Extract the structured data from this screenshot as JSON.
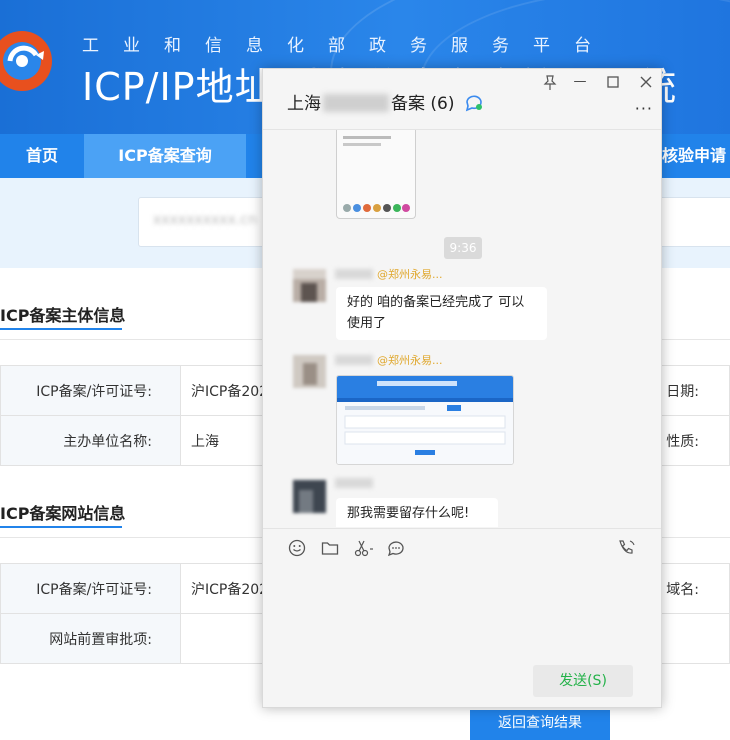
{
  "banner": {
    "slogan": "工业和信息化部政务服务平台",
    "title": "ICP/IP地址/域名信息备案管理系统"
  },
  "nav": {
    "items": [
      "首页",
      "ICP备案查询",
      "核验申请"
    ]
  },
  "search": {
    "value": ""
  },
  "subject_section": {
    "title": "ICP备案主体信息",
    "rows": [
      {
        "label": "ICP备案/许可证号:",
        "value": "沪ICP备202",
        "right_label": "日期:"
      },
      {
        "label": "主办单位名称:",
        "value": "上海",
        "right_label": "性质:"
      }
    ]
  },
  "website_section": {
    "title": "ICP备案网站信息",
    "rows": [
      {
        "label": "ICP备案/许可证号:",
        "value": "沪ICP备202",
        "right_label": "域名:"
      },
      {
        "label": "网站前置审批项:",
        "value": "",
        "right_label": ""
      }
    ]
  },
  "return_button": "返回查询结果",
  "chat": {
    "title_prefix": "上海",
    "title_suffix": "备案 (6)",
    "time": "9:36",
    "messages": [
      {
        "mention": "@郑州永易...",
        "text": "好的 咱的备案已经完成了 可以使用了"
      },
      {
        "mention": "@郑州永易...",
        "text": ""
      },
      {
        "mention": "",
        "text": "那我需要留存什么呢!"
      }
    ],
    "send_label": "发送(S)"
  },
  "colors": {
    "brand_blue": "#2183ea",
    "mention": "#e0a82e",
    "send_text": "#25b24a"
  }
}
